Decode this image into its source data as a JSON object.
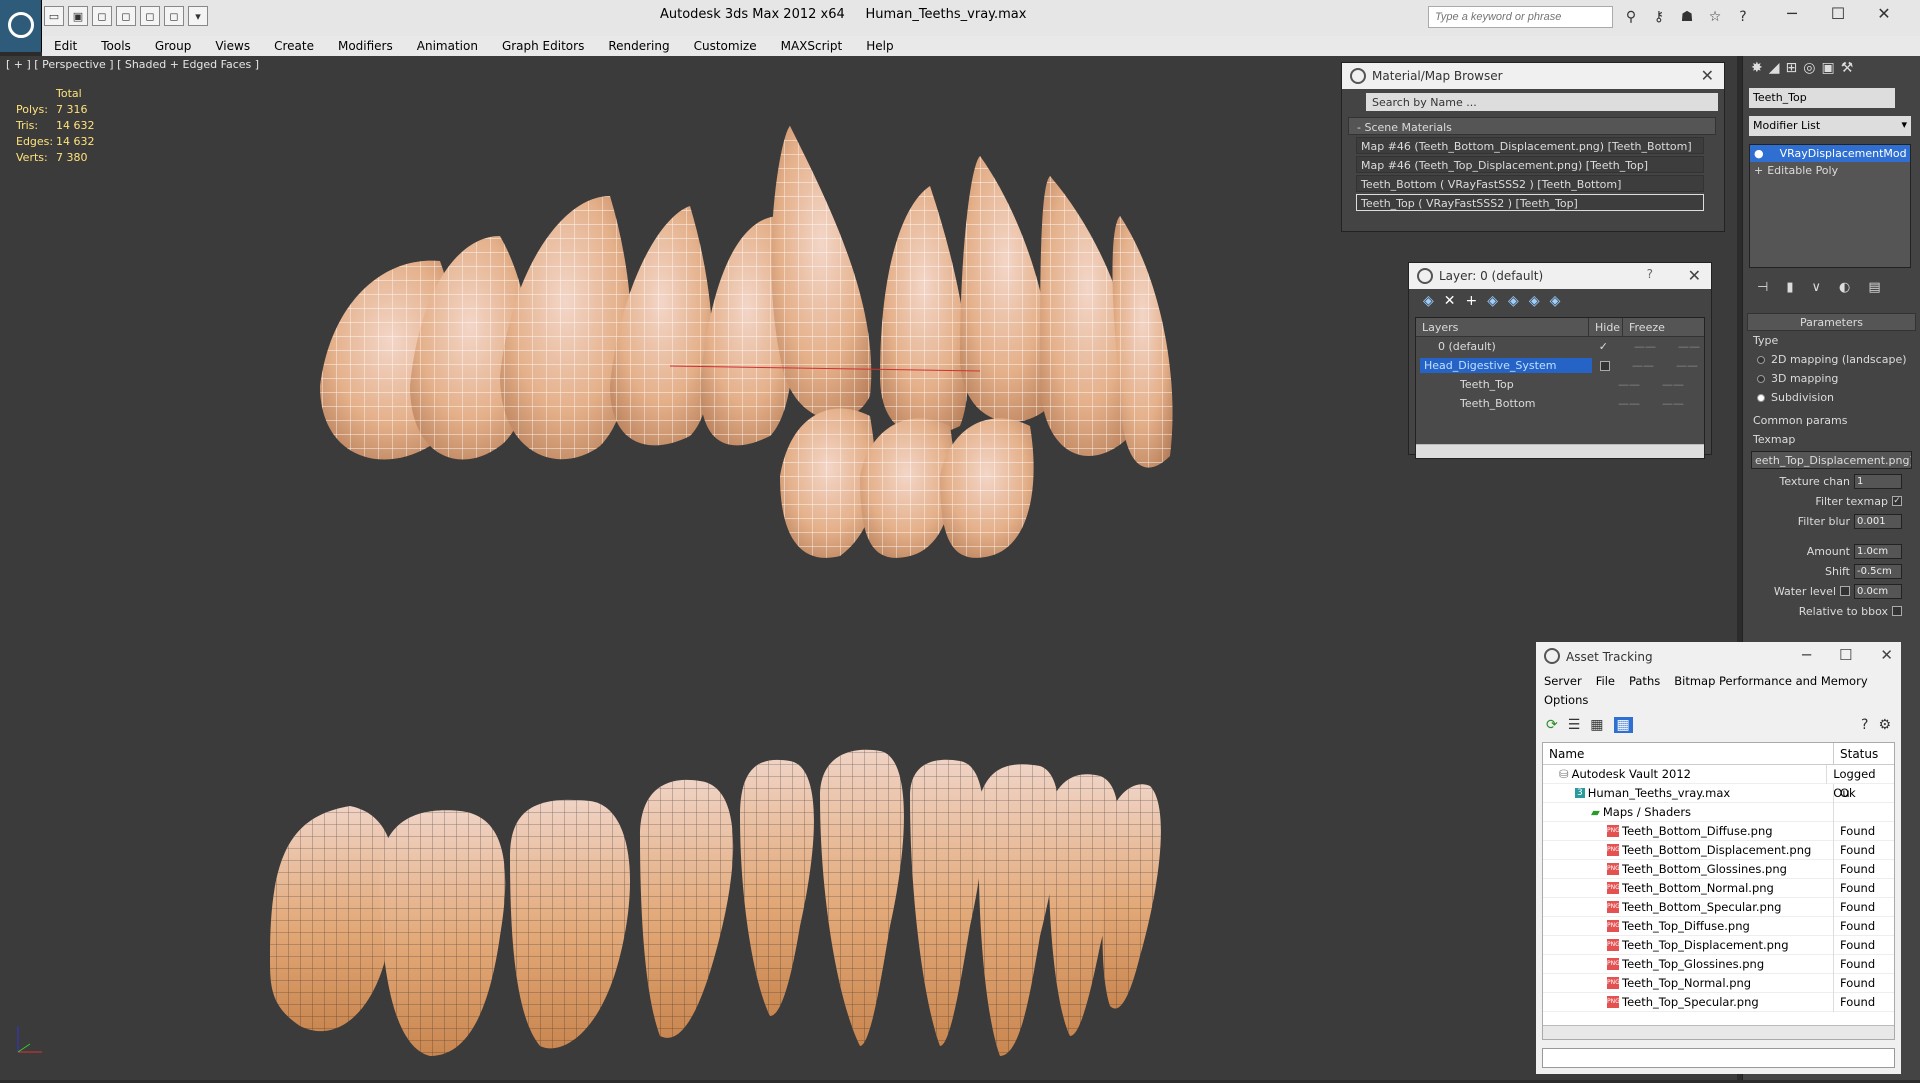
{
  "title": {
    "app": "Autodesk 3ds Max  2012 x64",
    "file": "Human_Teeths_vray.max",
    "search_placeholder": "Type a keyword or phrase"
  },
  "menu": [
    "Edit",
    "Tools",
    "Group",
    "Views",
    "Create",
    "Modifiers",
    "Animation",
    "Graph Editors",
    "Rendering",
    "Customize",
    "MAXScript",
    "Help"
  ],
  "viewport": {
    "label": "[ + ] [ Perspective ] [ Shaded + Edged Faces ]",
    "stats": {
      "header": "Total",
      "rows": [
        {
          "k": "Polys:",
          "v": "7 316"
        },
        {
          "k": "Tris:",
          "v": "14 632"
        },
        {
          "k": "Edges:",
          "v": "14 632"
        },
        {
          "k": "Verts:",
          "v": "7 380"
        }
      ]
    }
  },
  "material_browser": {
    "title": "Material/Map Browser",
    "search": "Search by Name ...",
    "section": "- Scene Materials",
    "items": [
      "Map #46 (Teeth_Bottom_Displacement.png) [Teeth_Bottom]",
      "Map #46 (Teeth_Top_Displacement.png) [Teeth_Top]",
      "Teeth_Bottom  ( VRayFastSSS2 ) [Teeth_Bottom]",
      "Teeth_Top  ( VRayFastSSS2 ) [Teeth_Top]"
    ]
  },
  "layer_panel": {
    "title": "Layer: 0 (default)",
    "help": "?",
    "cols": {
      "layers": "Layers",
      "hide": "Hide",
      "freeze": "Freeze"
    },
    "rows": [
      "0 (default)",
      "Head_Digestive_System",
      "Teeth_Top",
      "Teeth_Bottom"
    ]
  },
  "command_panel": {
    "object_name": "Teeth_Top",
    "modifier_list": "Modifier List",
    "stack": [
      "VRayDisplacementMod",
      "Editable Poly"
    ],
    "rollout": "Parameters",
    "type_label": "Type",
    "types": [
      "2D mapping (landscape)",
      "3D mapping",
      "Subdivision"
    ],
    "common": "Common params",
    "texmap_label": "Texmap",
    "texmap_value": "eeth_Top_Displacement.png)",
    "texture_chan_label": "Texture chan",
    "texture_chan": "1",
    "filter_texmap": "Filter texmap",
    "filter_blur_label": "Filter blur",
    "filter_blur": "0.001",
    "amount_label": "Amount",
    "amount": "1.0cm",
    "shift_label": "Shift",
    "shift": "-0.5cm",
    "water_label": "Water level",
    "water": "0.0cm",
    "relative": "Relative to bbox"
  },
  "asset_tracking": {
    "title": "Asset Tracking",
    "menu": [
      "Server",
      "File",
      "Paths",
      "Bitmap Performance and Memory",
      "Options"
    ],
    "cols": {
      "name": "Name",
      "status": "Status"
    },
    "rows": [
      {
        "name": "Autodesk Vault 2012",
        "status": "Logged Ou",
        "indent": 1
      },
      {
        "name": "Human_Teeths_vray.max",
        "status": "Ok",
        "indent": 2
      },
      {
        "name": "Maps / Shaders",
        "status": "",
        "indent": 3
      },
      {
        "name": "Teeth_Bottom_Diffuse.png",
        "status": "Found",
        "indent": 4
      },
      {
        "name": "Teeth_Bottom_Displacement.png",
        "status": "Found",
        "indent": 4
      },
      {
        "name": "Teeth_Bottom_Glossines.png",
        "status": "Found",
        "indent": 4
      },
      {
        "name": "Teeth_Bottom_Normal.png",
        "status": "Found",
        "indent": 4
      },
      {
        "name": "Teeth_Bottom_Specular.png",
        "status": "Found",
        "indent": 4
      },
      {
        "name": "Teeth_Top_Diffuse.png",
        "status": "Found",
        "indent": 4
      },
      {
        "name": "Teeth_Top_Displacement.png",
        "status": "Found",
        "indent": 4
      },
      {
        "name": "Teeth_Top_Glossines.png",
        "status": "Found",
        "indent": 4
      },
      {
        "name": "Teeth_Top_Normal.png",
        "status": "Found",
        "indent": 4
      },
      {
        "name": "Teeth_Top_Specular.png",
        "status": "Found",
        "indent": 4
      }
    ]
  },
  "colors": {
    "tooth": "#e8b48c",
    "wire": "#ffffff",
    "selection": "#2f6fd1"
  }
}
